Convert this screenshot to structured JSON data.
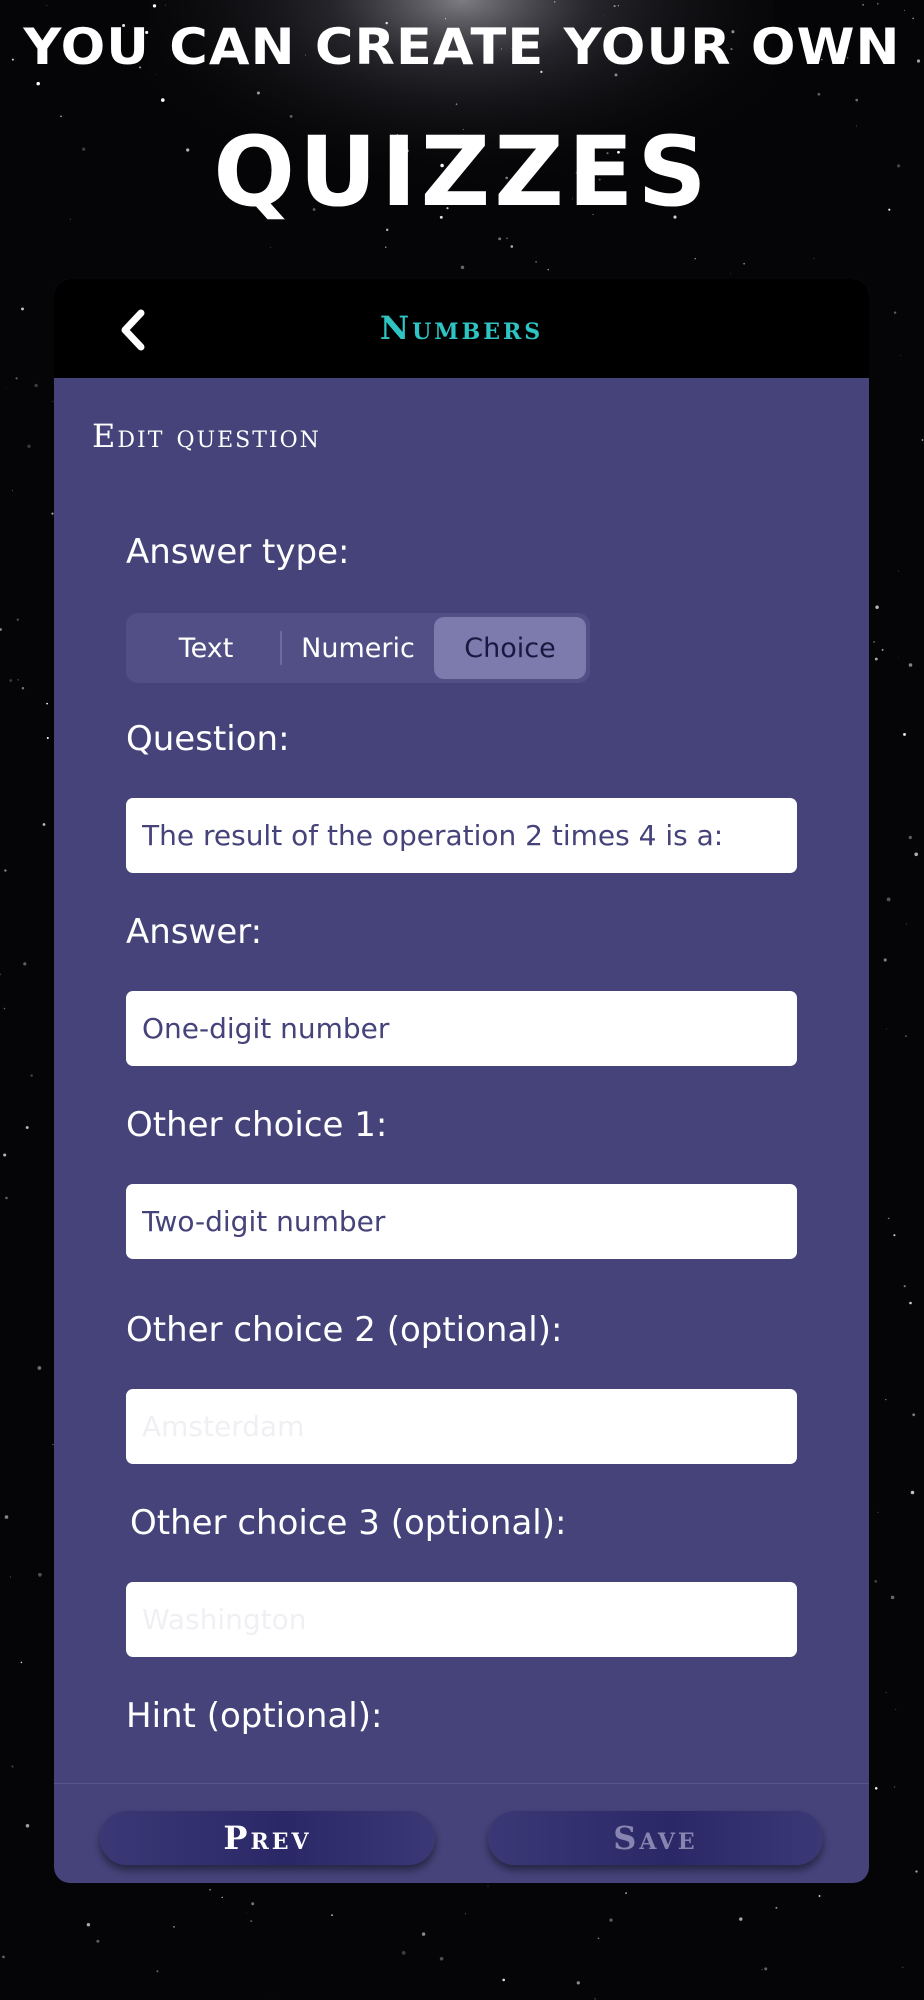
{
  "promo": {
    "line1": "YOU CAN CREATE YOUR OWN",
    "line2": "QUIZZES"
  },
  "header": {
    "back_icon": "chevron-left-icon",
    "title": "Numbers"
  },
  "form": {
    "section_title": "Edit question",
    "answer_type_label": "Answer type:",
    "answer_types": [
      "Text",
      "Numeric",
      "Choice"
    ],
    "selected_answer_type": "Choice",
    "question_label": "Question:",
    "question_value": "The result of the operation 2 times 4 is a:",
    "answer_label": "Answer:",
    "answer_value": "One-digit number",
    "choice1_label": "Other choice 1:",
    "choice1_value": "Two-digit number",
    "choice2_label": "Other choice 2 (optional):",
    "choice2_placeholder": "Amsterdam",
    "choice3_label": "Other choice 3 (optional):",
    "choice3_placeholder": "Washington",
    "hint_label": "Hint (optional):"
  },
  "footer": {
    "prev_label": "Prev",
    "save_label": "Save"
  },
  "colors": {
    "card_background": "#45437a",
    "header_background": "#000000",
    "title_accent": "#2ec4c4",
    "segment_selected": "#7d7aae",
    "save_disabled_text": "#8886b0"
  }
}
